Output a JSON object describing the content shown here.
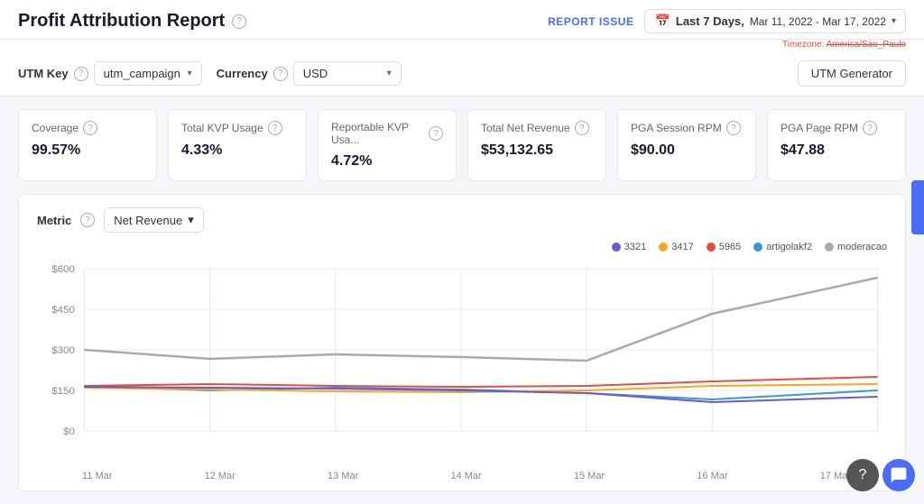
{
  "header": {
    "title": "Profit Attribution Report",
    "report_issue_label": "REPORT ISSUE",
    "date_range_bold": "Last 7 Days,",
    "date_range_detail": "Mar 11, 2022 - Mar 17, 2022",
    "timezone_label": "Timezone:",
    "timezone_value": "America/S...",
    "help_icon": "?"
  },
  "toolbar": {
    "utm_key_label": "UTM Key",
    "utm_key_value": "utm_campaign",
    "currency_label": "Currency",
    "currency_value": "USD",
    "utm_generator_label": "UTM Generator"
  },
  "kpi_cards": [
    {
      "label": "Coverage",
      "value": "99.57%"
    },
    {
      "label": "Total KVP Usage",
      "value": "4.33%"
    },
    {
      "label": "Reportable KVP Usa...",
      "value": "4.72%"
    },
    {
      "label": "Total Net Revenue",
      "value": "$53,132.65"
    },
    {
      "label": "PGA Session RPM",
      "value": "$90.00"
    },
    {
      "label": "PGA Page RPM",
      "value": "$47.88"
    }
  ],
  "chart": {
    "metric_label": "Metric",
    "metric_value": "Net Revenue",
    "legend": [
      {
        "id": "3321",
        "color": "#6a5acd"
      },
      {
        "id": "3417",
        "color": "#f5a623"
      },
      {
        "id": "5965",
        "color": "#e74c3c"
      },
      {
        "id": "artigolakf2",
        "color": "#3498db"
      },
      {
        "id": "moderacao",
        "color": "#aaa"
      }
    ],
    "y_labels": [
      "$600",
      "$450",
      "$300",
      "$150",
      "$0"
    ],
    "x_labels": [
      "11 Mar",
      "12 Mar",
      "13 Mar",
      "14 Mar",
      "15 Mar",
      "16 Mar",
      "17 Mar"
    ]
  },
  "icons": {
    "calendar": "📅",
    "chevron_down": "▾",
    "help": "?",
    "chat": "💬"
  }
}
